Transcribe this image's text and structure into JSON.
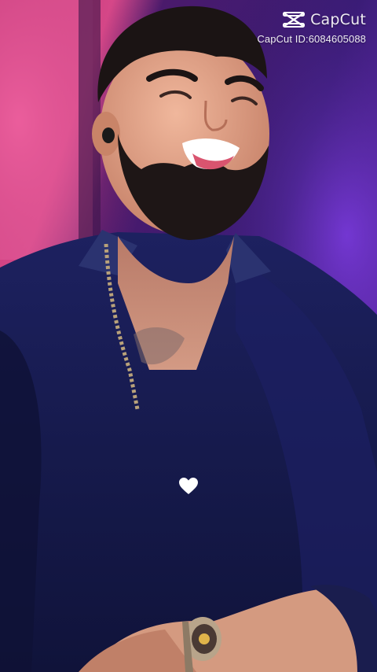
{
  "watermark": {
    "brand": "CapCut",
    "id_text": "CapCut ID:6084605088",
    "logo_icon": "capcut-logo-icon"
  },
  "overlay": {
    "icon": "white-heart-icon",
    "color": "#ffffff"
  },
  "colors": {
    "left_glow": "#d63b86",
    "background_purple": "#5a22a8",
    "shirt_navy": "#171a4a",
    "skin": "#e0a58e"
  }
}
